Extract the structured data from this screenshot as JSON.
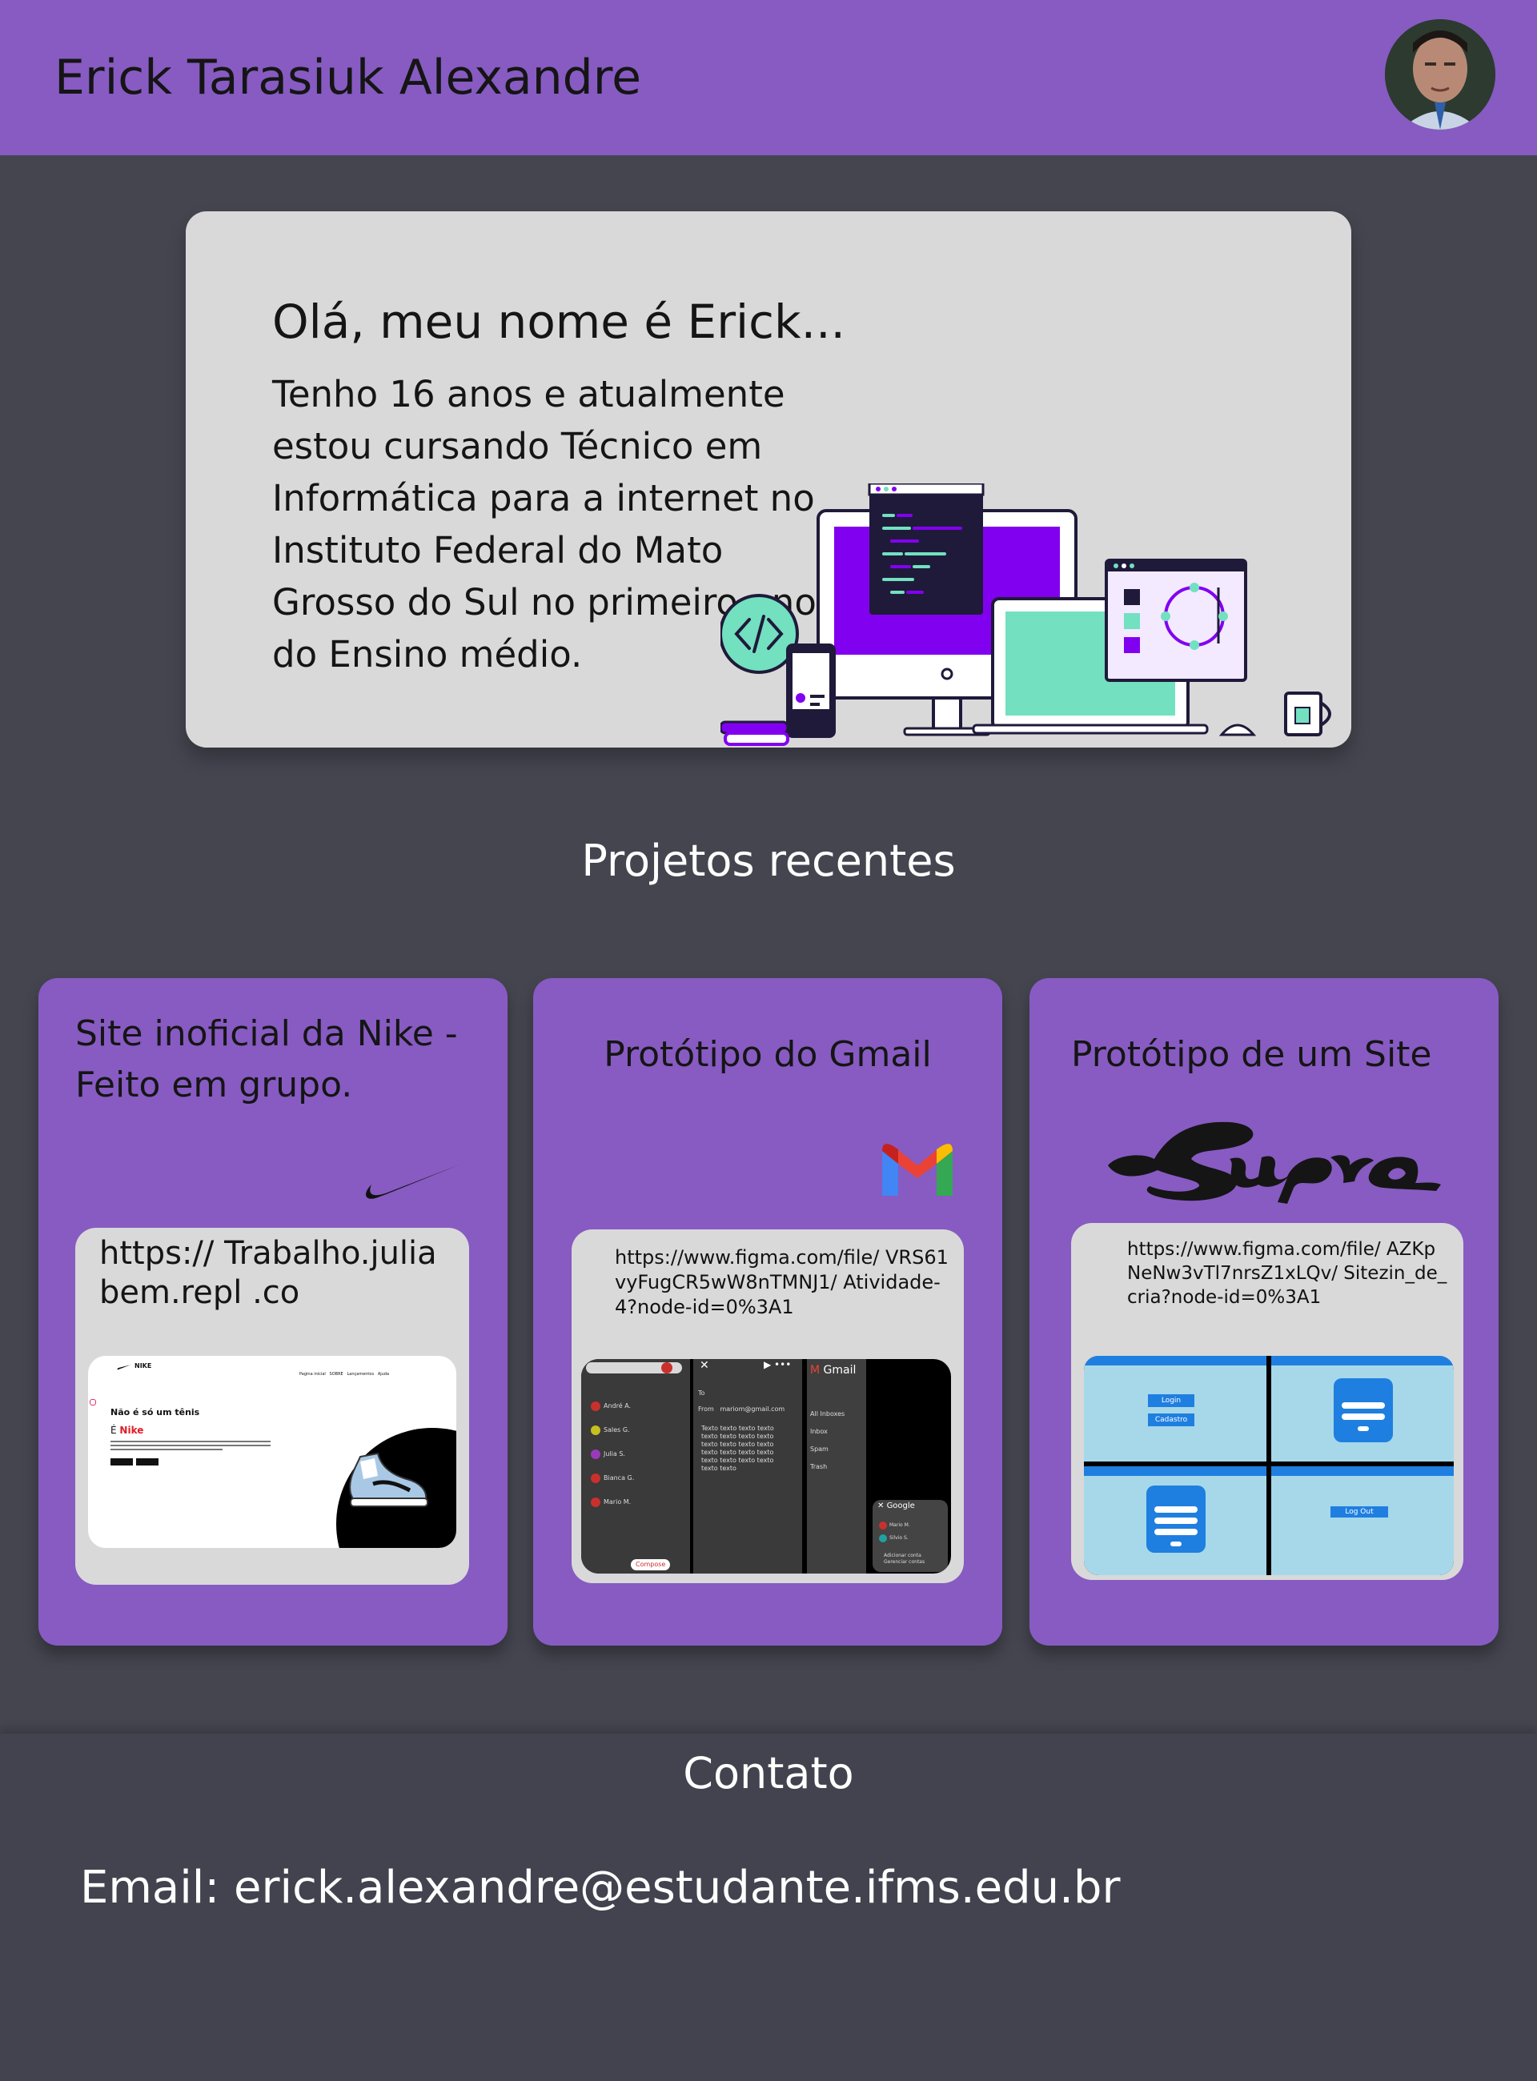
{
  "header": {
    "name": "Erick Tarasiuk Alexandre"
  },
  "intro": {
    "heading": "Olá, meu nome é Erick...",
    "bio": "Tenho 16 anos e atualmente estou cursando Técnico em Informática para a internet no Instituto Federal do Mato Grosso do Sul no primeiro ano do Ensino médio."
  },
  "projects": {
    "title": "Projetos recentes",
    "items": [
      {
        "title": "Site inoficial da Nike - Feito em grupo.",
        "logo": "nike-swoosh-icon",
        "url": "https:// Trabalho.juliabem.repl .co",
        "preview": {
          "brand": "NIKE",
          "nav": "Pagina inicial   SOBRE   Lançamentos   Ajuda",
          "headline": "Não é só um tênis",
          "sub_prefix": "É",
          "sub_brand": "Nike"
        }
      },
      {
        "title": "Protótipo do Gmail",
        "logo": "gmail-icon",
        "url": "https://www.figma.com/file/ VRS61vyFugCR5wW8nTMNJ1/ Atividade-4?node-id=0%3A1",
        "preview": {
          "contacts": [
            "André A.",
            "Sales G.",
            "Julia S.",
            "Bianca G.",
            "Mario M."
          ],
          "to_label": "To",
          "from_label": "From",
          "from_value": "mariom@gmail.com",
          "body": "Texto texto texto texto texto texto texto texto texto texto texto texto texto texto texto texto texto texto texto texto texto texto",
          "menu_title": "Gmail",
          "menu_items": [
            "All Inboxes",
            "Inbox",
            "Spam",
            "Trash"
          ],
          "compose": "Compose",
          "account_title": "Google",
          "account_items": [
            "Mario M.",
            "Silvio S."
          ],
          "account_footer": "Adicionar conta Gerenciar contas"
        }
      },
      {
        "title": "Protótipo de um Site",
        "logo": "supra-logo",
        "url": "https://www.figma.com/file/ AZKpNeNw3vTl7nrsZ1xLQv/ Sitezin_de_cria?node-id=0%3A1",
        "preview": {
          "buttons": [
            "Login",
            "Cadastro"
          ],
          "logout": "Log Out"
        }
      }
    ]
  },
  "contact": {
    "title": "Contato",
    "email": "Email: erick.alexandre@estudante.ifms.edu.br"
  },
  "colors": {
    "background": "#454550",
    "accent": "#875bc2",
    "card_inner": "#d9d9d9",
    "illustration_purple": "#8200f0",
    "illustration_mint": "#73e0c0"
  }
}
